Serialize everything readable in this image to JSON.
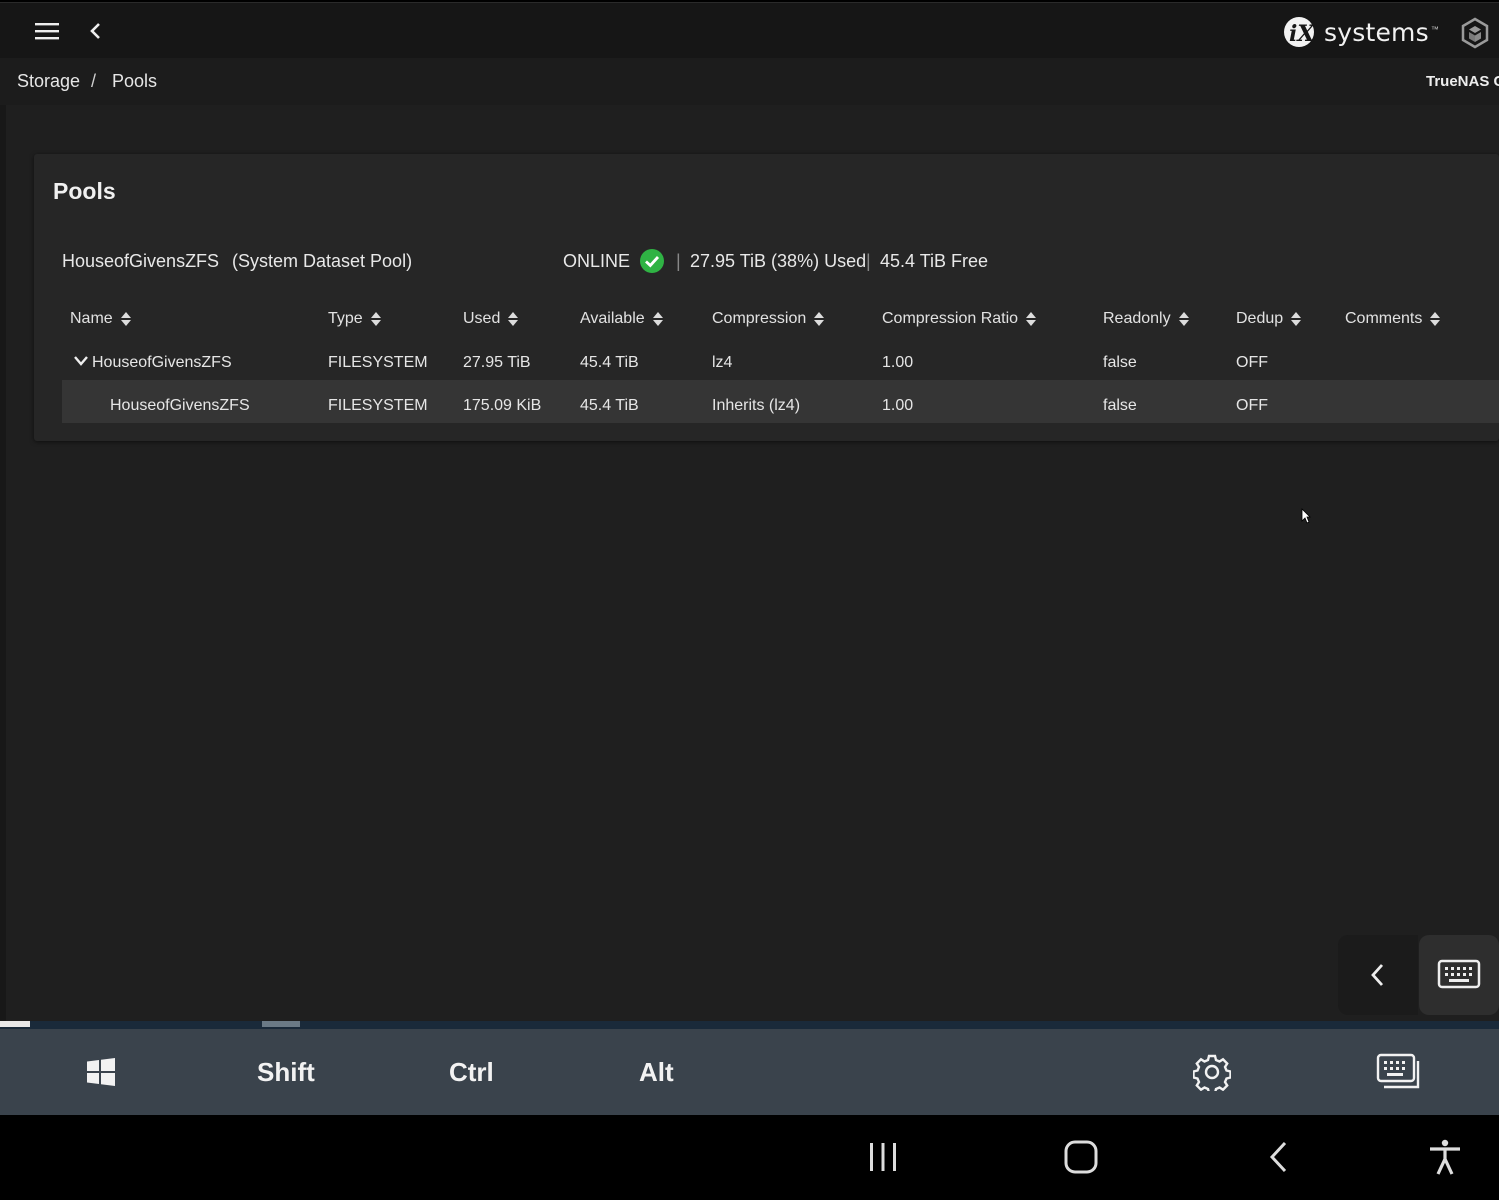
{
  "breadcrumb": {
    "storage": "Storage",
    "separator": "/",
    "pools": "Pools"
  },
  "header": {
    "logo_text": "systems",
    "logo_mark": "iX",
    "hostname": "TrueNAS C"
  },
  "card": {
    "title": "Pools",
    "pool_name": "HouseofGivensZFS",
    "pool_role": "(System Dataset Pool)",
    "status": "ONLINE",
    "pipe": "|",
    "used_summary": "27.95 TiB (38%) Used",
    "free_summary": "45.4 TiB Free"
  },
  "table": {
    "columns": [
      "Name",
      "Type",
      "Used",
      "Available",
      "Compression",
      "Compression Ratio",
      "Readonly",
      "Dedup",
      "Comments"
    ],
    "rows": [
      {
        "name": "HouseofGivensZFS",
        "type": "FILESYSTEM",
        "used": "27.95 TiB",
        "available": "45.4 TiB",
        "compression": "lz4",
        "ratio": "1.00",
        "readonly": "false",
        "dedup": "OFF",
        "comments": ""
      },
      {
        "name": "HouseofGivensZFS",
        "type": "FILESYSTEM",
        "used": "175.09 KiB",
        "available": "45.4 TiB",
        "compression": "Inherits (lz4)",
        "ratio": "1.00",
        "readonly": "false",
        "dedup": "OFF",
        "comments": ""
      }
    ]
  },
  "keyboard_bar": {
    "shift": "Shift",
    "ctrl": "Ctrl",
    "alt": "Alt"
  },
  "icons": {
    "menu": "hamburger-menu-icon",
    "back": "chevron-left-icon",
    "status": "check-circle-icon",
    "sort": "sort-arrows-icon",
    "windows": "windows-icon",
    "settings": "gear-icon",
    "keyboard": "keyboard-icon"
  },
  "colors": {
    "status_ok": "#2fb344",
    "topbar": "#161616",
    "card": "#262626",
    "keyboard_bar": "#3a434c"
  }
}
